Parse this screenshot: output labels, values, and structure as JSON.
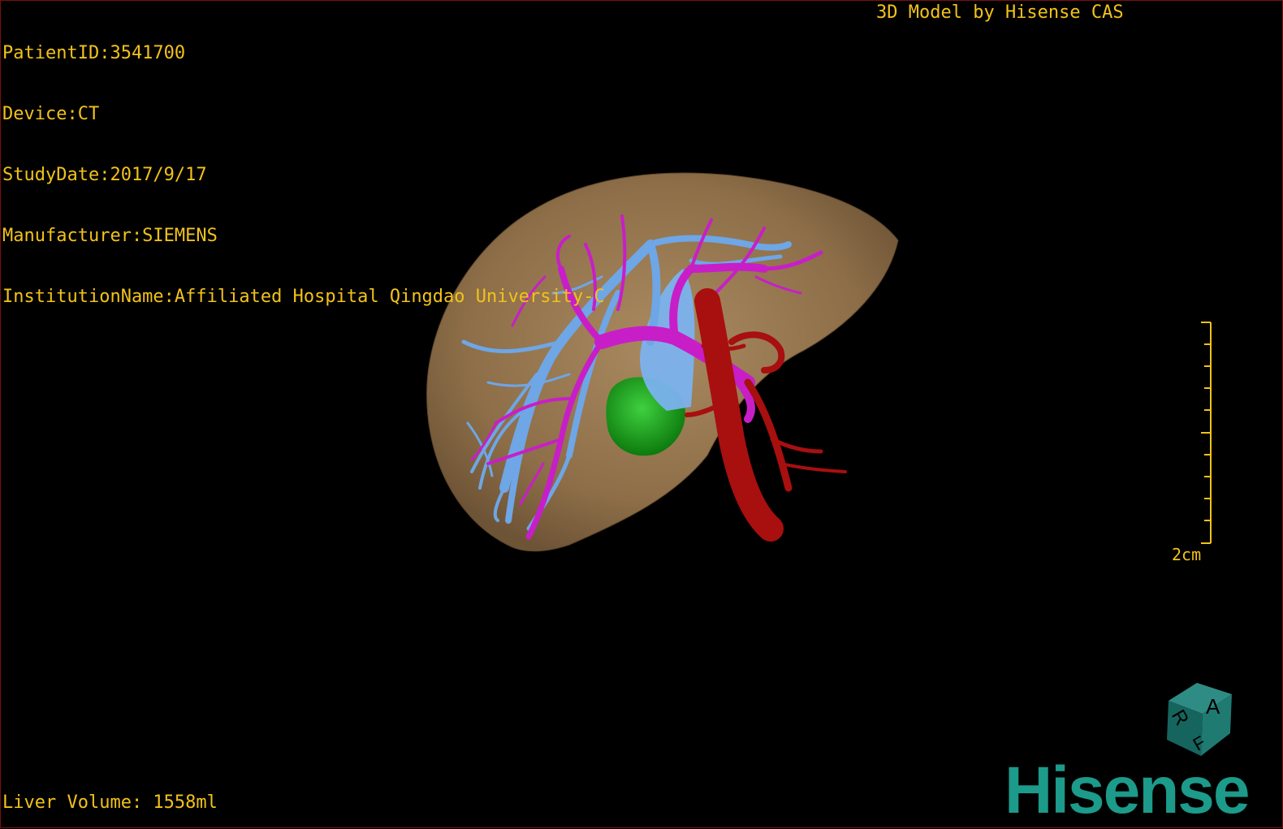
{
  "study_info": {
    "patient_id": "PatientID:3541700",
    "device": "Device:CT",
    "study_date": "StudyDate:2017/9/17",
    "manufacturer": "Manufacturer:SIEMENS",
    "institution": "InstitutionName:Affiliated Hospital Qingdao University-C"
  },
  "credit": "3D Model by Hisense CAS",
  "liver_volume": "Liver Volume: 1558ml",
  "scale_bar": {
    "label": "2cm"
  },
  "orientation_cube": {
    "face_a": "A",
    "face_r": "R",
    "face_f": "F",
    "icon": "orientation-cube-icon"
  },
  "brand": "Hisense",
  "colors": {
    "overlay_text": "#f2c21a",
    "liver": "#9c7b52",
    "portal_vein": "#c81ec8",
    "hepatic_vein": "#6ea6e6",
    "artery": "#a80f0f",
    "gallbladder": "#15a015",
    "brand": "#1c9a8a"
  }
}
